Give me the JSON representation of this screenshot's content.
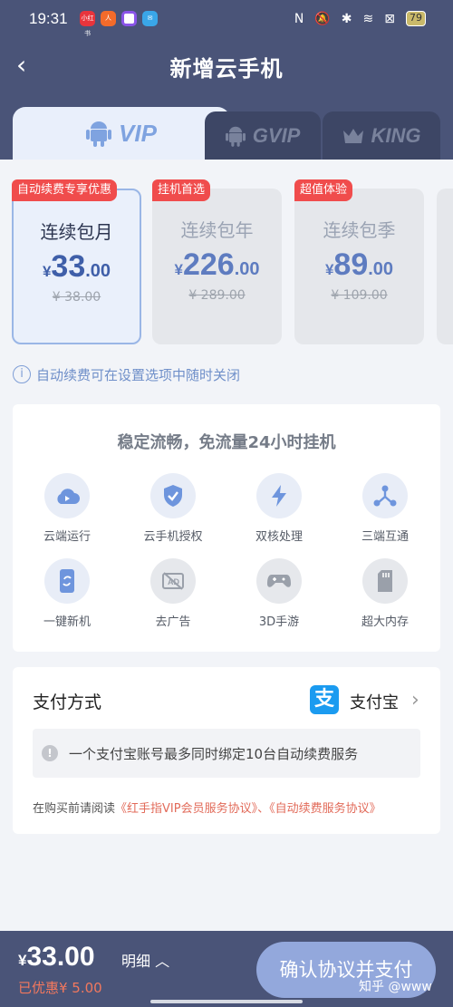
{
  "status_bar": {
    "time": "19:31",
    "battery": "79",
    "app_icons": [
      "小红书",
      "人",
      "",
      "✉"
    ]
  },
  "nav": {
    "title": "新增云手机",
    "back_icon": "chevron-left-icon"
  },
  "tabs": [
    {
      "label": "VIP",
      "active": true,
      "icon": "android-icon"
    },
    {
      "label": "GVIP",
      "active": false,
      "icon": "android-icon"
    },
    {
      "label": "KING",
      "active": false,
      "icon": "crown-icon"
    }
  ],
  "plans": [
    {
      "badge": "自动续费专享优惠",
      "name": "连续包月",
      "currency": "¥",
      "price_int": "33",
      "price_dec": ".00",
      "original": "¥ 38.00",
      "selected": true
    },
    {
      "badge": "挂机首选",
      "name": "连续包年",
      "currency": "¥",
      "price_int": "226",
      "price_dec": ".00",
      "original": "¥ 289.00",
      "selected": false
    },
    {
      "badge": "超值体验",
      "name": "连续包季",
      "currency": "¥",
      "price_int": "89",
      "price_dec": ".00",
      "original": "¥ 109.00",
      "selected": false
    }
  ],
  "notice": "自动续费可在设置选项中随时关闭",
  "features": {
    "title": "稳定流畅，免流量24小时挂机",
    "items": [
      {
        "label": "云端运行",
        "icon": "cloud-play-icon"
      },
      {
        "label": "云手机授权",
        "icon": "shield-check-icon"
      },
      {
        "label": "双核处理",
        "icon": "lightning-icon"
      },
      {
        "label": "三端互通",
        "icon": "share-nodes-icon"
      },
      {
        "label": "一键新机",
        "icon": "phone-refresh-icon"
      },
      {
        "label": "去广告",
        "icon": "ad-block-icon"
      },
      {
        "label": "3D手游",
        "icon": "gamepad-icon"
      },
      {
        "label": "超大内存",
        "icon": "sd-card-icon"
      }
    ]
  },
  "payment": {
    "label": "支付方式",
    "method": "支付宝",
    "method_icon": "alipay-icon",
    "tip": "一个支付宝账号最多同时绑定10台自动续费服务",
    "agreement_prefix": "在购买前请阅读",
    "agreement_link1": "《红手指VIP会员服务协议》",
    "agreement_sep": "、",
    "agreement_link2": "《自动续费服务协议》"
  },
  "bottom": {
    "currency": "¥",
    "total": "33.00",
    "detail_label": "明细",
    "discount": "已优惠¥ 5.00",
    "confirm_label": "确认协议并支付",
    "watermark": "知乎 @www"
  },
  "colors": {
    "header": "#4a5478",
    "accent": "#3f5fa9",
    "badge": "#f04c4c",
    "button": "#93a8dc"
  }
}
